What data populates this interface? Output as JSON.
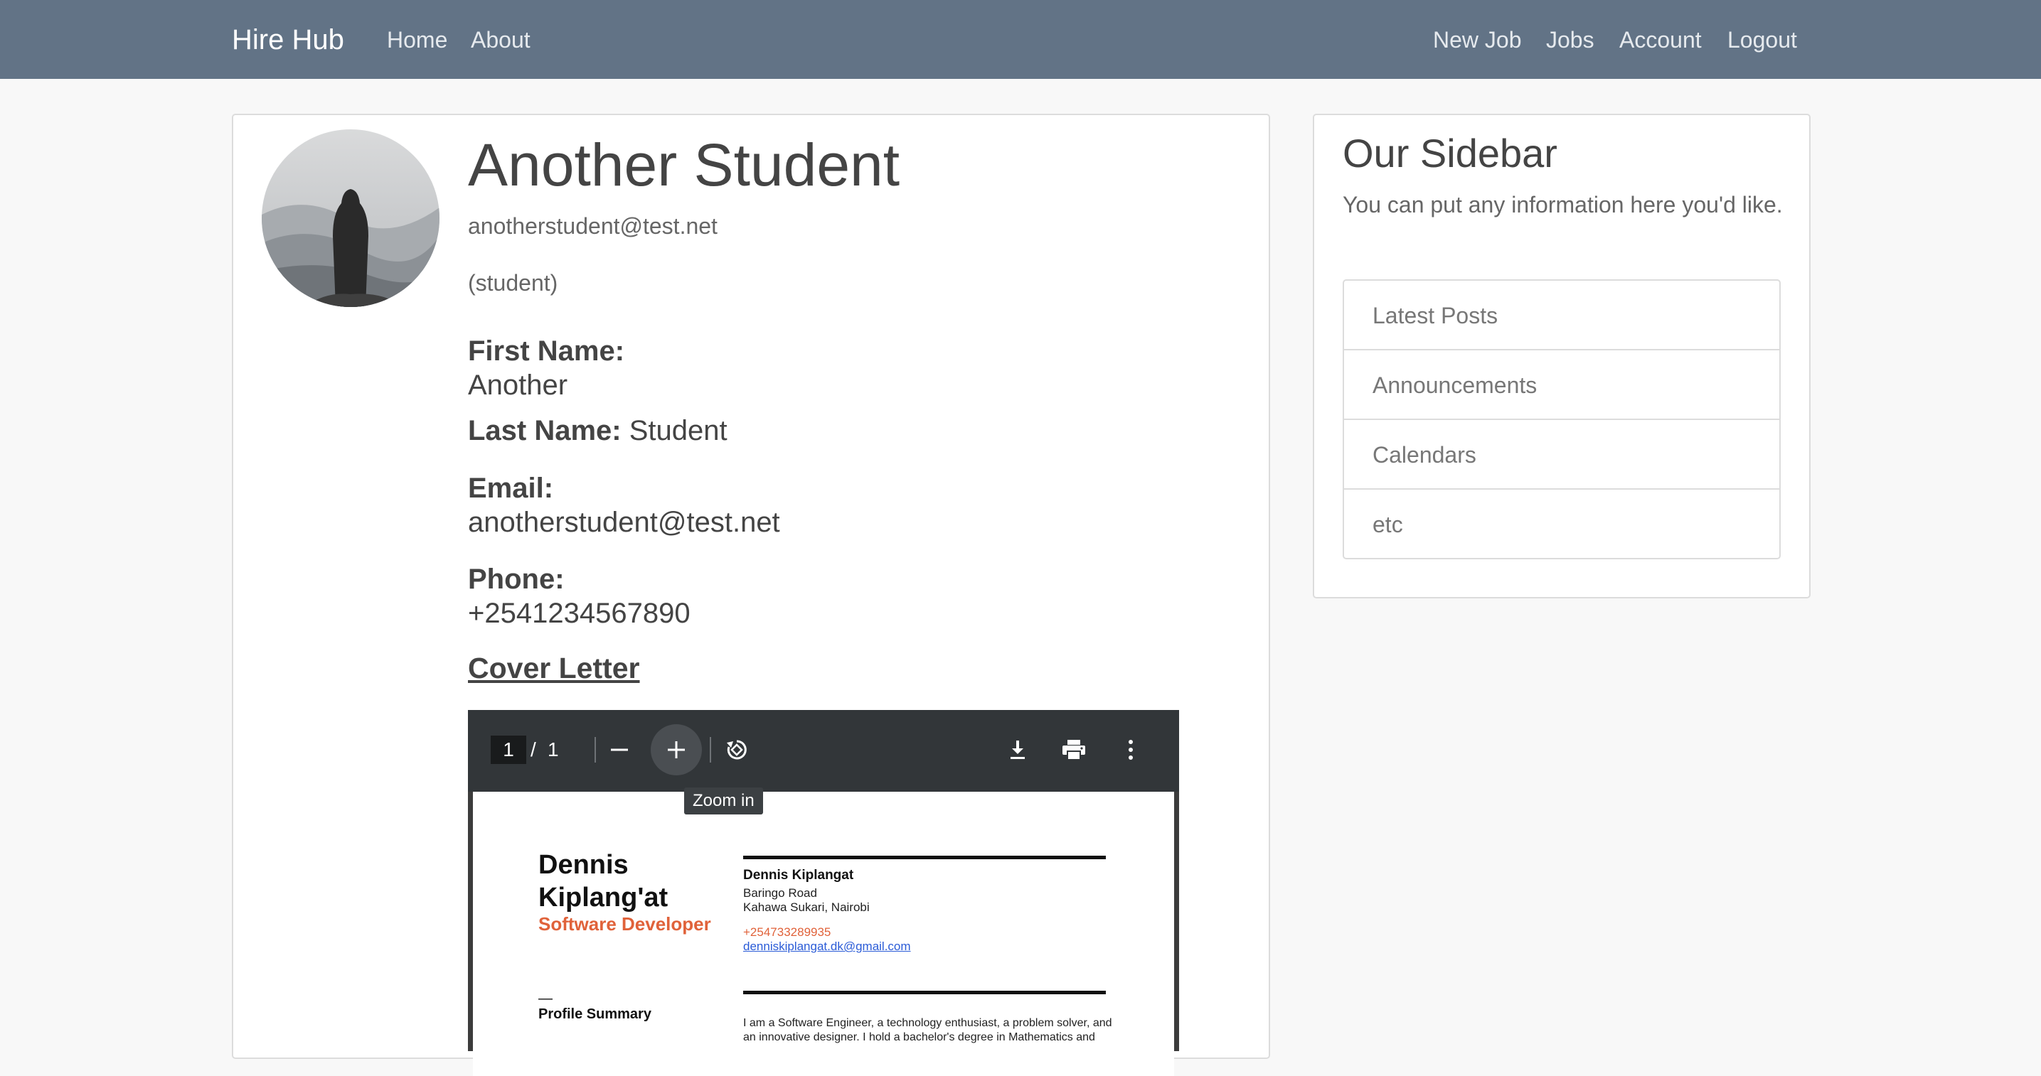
{
  "navbar": {
    "brand": "Hire Hub",
    "left_links": [
      "Home",
      "About"
    ],
    "right_links": [
      "New Job",
      "Jobs",
      "Account",
      "Logout"
    ]
  },
  "profile": {
    "name": "Another Student",
    "email": "anotherstudent@test.net",
    "role": "(student)",
    "fields": {
      "first_name_label": "First Name:",
      "first_name": "Another",
      "last_name_label": "Last Name:",
      "last_name": "Student",
      "email_label": "Email:",
      "email": "anotherstudent@test.net",
      "phone_label": "Phone:",
      "phone": "+2541234567890"
    },
    "cover_letter_link": "Cover Letter"
  },
  "pdf_viewer": {
    "current_page": "1",
    "separator": "/",
    "total_pages": "1",
    "tooltip": "Zoom in",
    "icons": [
      "zoom-out-icon",
      "zoom-in-icon",
      "rotate-icon",
      "download-icon",
      "print-icon",
      "more-options-icon"
    ],
    "document": {
      "name_line1": "Dennis",
      "name_line2": "Kiplang'at",
      "title": "Software Developer",
      "contact_name": "Dennis Kiplangat",
      "address1": "Baringo Road",
      "address2": "Kahawa Sukari, Nairobi",
      "phone": "+254733289935",
      "email": "denniskiplangat.dk@gmail.com",
      "section_dash": "—",
      "section_title": "Profile Summary",
      "summary_line1": "I am a Software Engineer, a technology enthusiast, a problem solver, and",
      "summary_line2": "an innovative designer. I hold a bachelor's degree in Mathematics and"
    }
  },
  "sidebar": {
    "title": "Our Sidebar",
    "text": "You can put any information here you'd like.",
    "items": [
      "Latest Posts",
      "Announcements",
      "Calendars",
      "etc"
    ]
  }
}
